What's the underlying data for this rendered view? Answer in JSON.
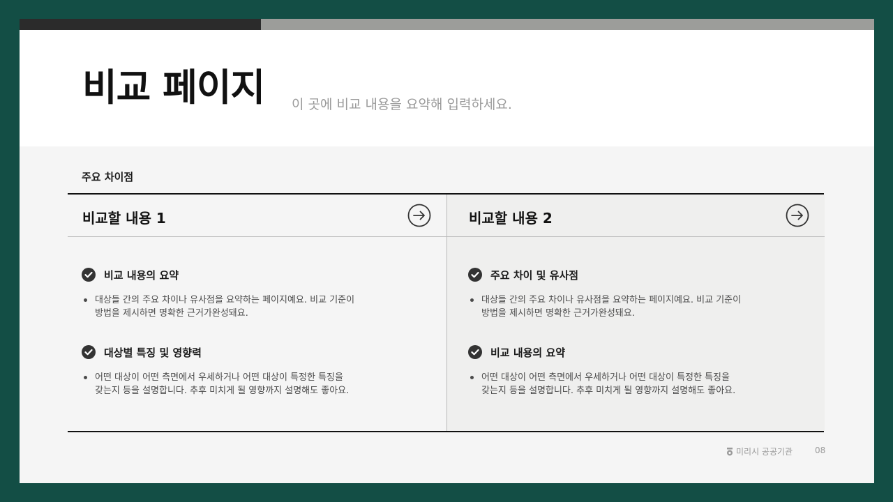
{
  "header": {
    "title": "비교 페이지",
    "subtitle": "이 곳에 비교 내용을 요약해 입력하세요."
  },
  "section_label": "주요 차이점",
  "columns": [
    {
      "title": "비교할 내용 1",
      "items": [
        {
          "heading": "비교 내용의 요약",
          "lines": [
            "대상들 간의 주요 차이나 유사점을 요약하는 페이지예요. 비교 기준이",
            "방법을 제시하면 명확한 근거가완성돼요."
          ]
        },
        {
          "heading": "대상별 특징 및 영향력",
          "lines": [
            "어떤 대상이 어떤 측면에서 우세하거나 어떤 대상이 특정한 특징을",
            "갖는지 등을 설명합니다. 추후 미치게 될 영향까지 설명해도 좋아요."
          ]
        }
      ]
    },
    {
      "title": "비교할 내용 2",
      "items": [
        {
          "heading": "주요 차이 및 유사점",
          "lines": [
            "대상들 간의 주요 차이나 유사점을 요약하는 페이지예요. 비교 기준이",
            "방법을 제시하면 명확한 근거가완성돼요."
          ]
        },
        {
          "heading": "비교 내용의 요약",
          "lines": [
            "어떤 대상이 어떤 측면에서 우세하거나 어떤 대상이 특정한 특징을",
            "갖는지 등을 설명합니다. 추후 미치게 될 영향까지 설명해도 좋아요."
          ]
        }
      ]
    }
  ],
  "footer": {
    "org": "미리시 공공기관",
    "page": "08"
  },
  "icons": {
    "item": "check-circle-icon",
    "header_button": "arrow-right-circle-icon",
    "footer": "badge-icon"
  },
  "colors": {
    "frame": "#134e45",
    "accent_dark": "#2b2b2b",
    "accent_gray": "#9c9d9a"
  }
}
